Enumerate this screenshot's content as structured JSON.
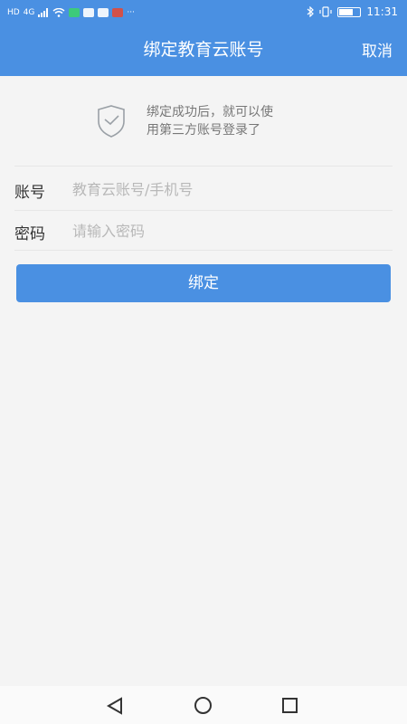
{
  "status_bar": {
    "network_badge": "HD",
    "signal_label": "4G",
    "time": "11:31",
    "more": "···"
  },
  "header": {
    "title": "绑定教育云账号",
    "cancel_label": "取消",
    "background_color": "#4a90e2"
  },
  "notice": {
    "icon": "shield-check-icon",
    "line1": "绑定成功后，就可以使",
    "line2": "用第三方账号登录了"
  },
  "form": {
    "account": {
      "label": "账号",
      "placeholder": "教育云账号/手机号",
      "value": ""
    },
    "password": {
      "label": "密码",
      "placeholder": "请输入密码",
      "value": ""
    },
    "submit_label": "绑定"
  },
  "navbar": {
    "back_icon": "back-triangle-icon",
    "home_icon": "home-circle-icon",
    "recent_icon": "recent-square-icon"
  }
}
